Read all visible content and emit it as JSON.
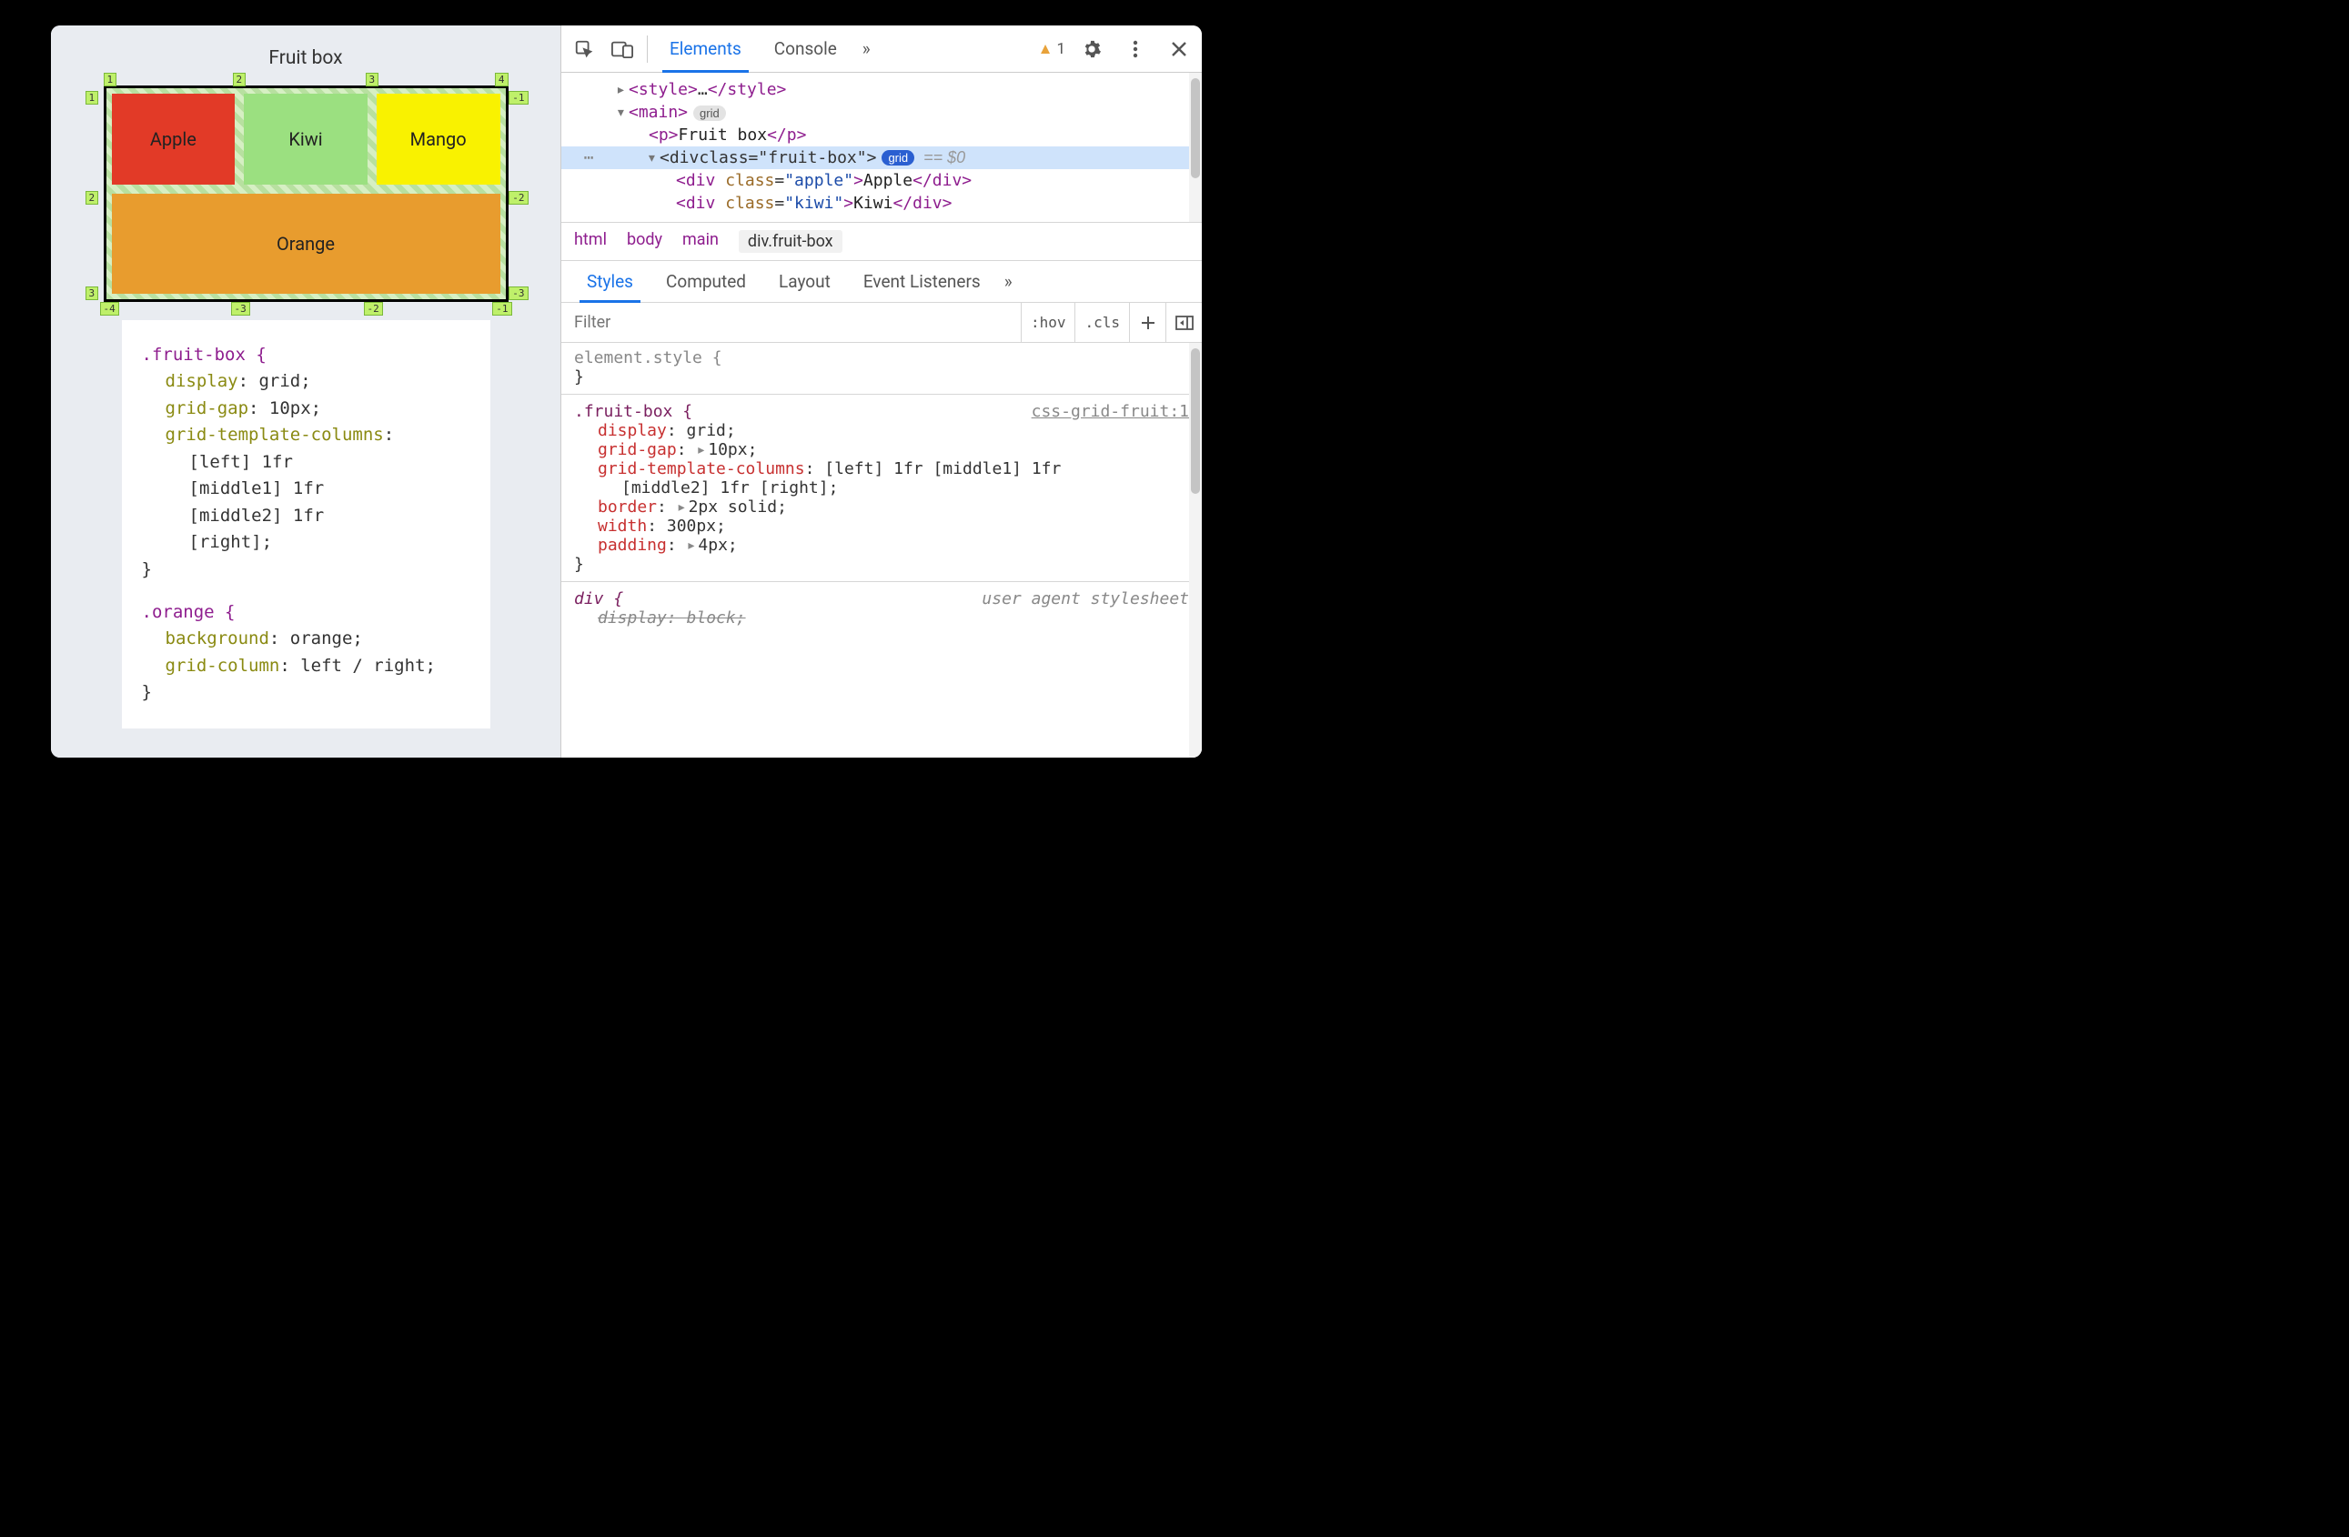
{
  "page": {
    "title": "Fruit box",
    "cells": {
      "apple": "Apple",
      "kiwi": "Kiwi",
      "mango": "Mango",
      "orange": "Orange"
    },
    "grid_labels": {
      "top": [
        "1",
        "2",
        "3",
        "4"
      ],
      "bottom": [
        "-4",
        "-3",
        "-2",
        "-1"
      ],
      "left": [
        "1",
        "2",
        "3"
      ],
      "right": [
        "-1",
        "-2",
        "-3"
      ]
    },
    "code": {
      "sel1": ".fruit-box {",
      "p1": "display",
      "v1": "grid;",
      "p2": "grid-gap",
      "v2": "10px;",
      "p3": "grid-template-columns",
      "v3": ":",
      "l1": "[left] 1fr",
      "l2": "[middle1] 1fr",
      "l3": "[middle2] 1fr",
      "l4": "[right];",
      "close1": "}",
      "sel2": ".orange {",
      "p4": "background",
      "v4": "orange;",
      "p5": "grid-column",
      "v5": "left / right;",
      "close2": "}"
    }
  },
  "devtools": {
    "tabs": {
      "elements": "Elements",
      "console": "Console"
    },
    "more": "»",
    "warn_count": "1",
    "dom": {
      "l1a": "<style>",
      "l1b": "…",
      "l1c": "</style>",
      "l2a": "<main>",
      "l2_badge": "grid",
      "l3a": "<p>",
      "l3t": "Fruit box",
      "l3b": "</p>",
      "l4a": "<div ",
      "l4attr": "class",
      "l4val": "\"fruit-box\"",
      "l4b": ">",
      "l4_badge": "grid",
      "l4_eq": "== $0",
      "l5a": "<div ",
      "l5attr": "class",
      "l5val": "\"apple\"",
      "l5b": ">",
      "l5t": "Apple",
      "l5c": "</div>",
      "l6a": "<div ",
      "l6attr": "class",
      "l6val": "\"kiwi\"",
      "l6b": ">",
      "l6t": "Kiwi",
      "l6c": "</div>"
    },
    "breadcrumb": [
      "html",
      "body",
      "main",
      "div.fruit-box"
    ],
    "styles_tabs": [
      "Styles",
      "Computed",
      "Layout",
      "Event Listeners"
    ],
    "filter_placeholder": "Filter",
    "hov": ":hov",
    "cls": ".cls",
    "rules": {
      "elstyle": "element.style {",
      "close": "}",
      "sel": ".fruit-box {",
      "src": "css-grid-fruit:1",
      "p_display": "display",
      "v_display": "grid;",
      "p_gap": "grid-gap",
      "v_gap": "10px;",
      "p_cols": "grid-template-columns",
      "v_cols": "[left] 1fr [middle1] 1fr",
      "v_cols2": "[middle2] 1fr [right];",
      "p_border": "border",
      "v_border": "2px solid;",
      "p_width": "width",
      "v_width": "300px;",
      "p_pad": "padding",
      "v_pad": "4px;",
      "ua_src": "user agent stylesheet",
      "ua_sel": "div {",
      "ua_p": "display",
      "ua_v": "block;"
    }
  }
}
